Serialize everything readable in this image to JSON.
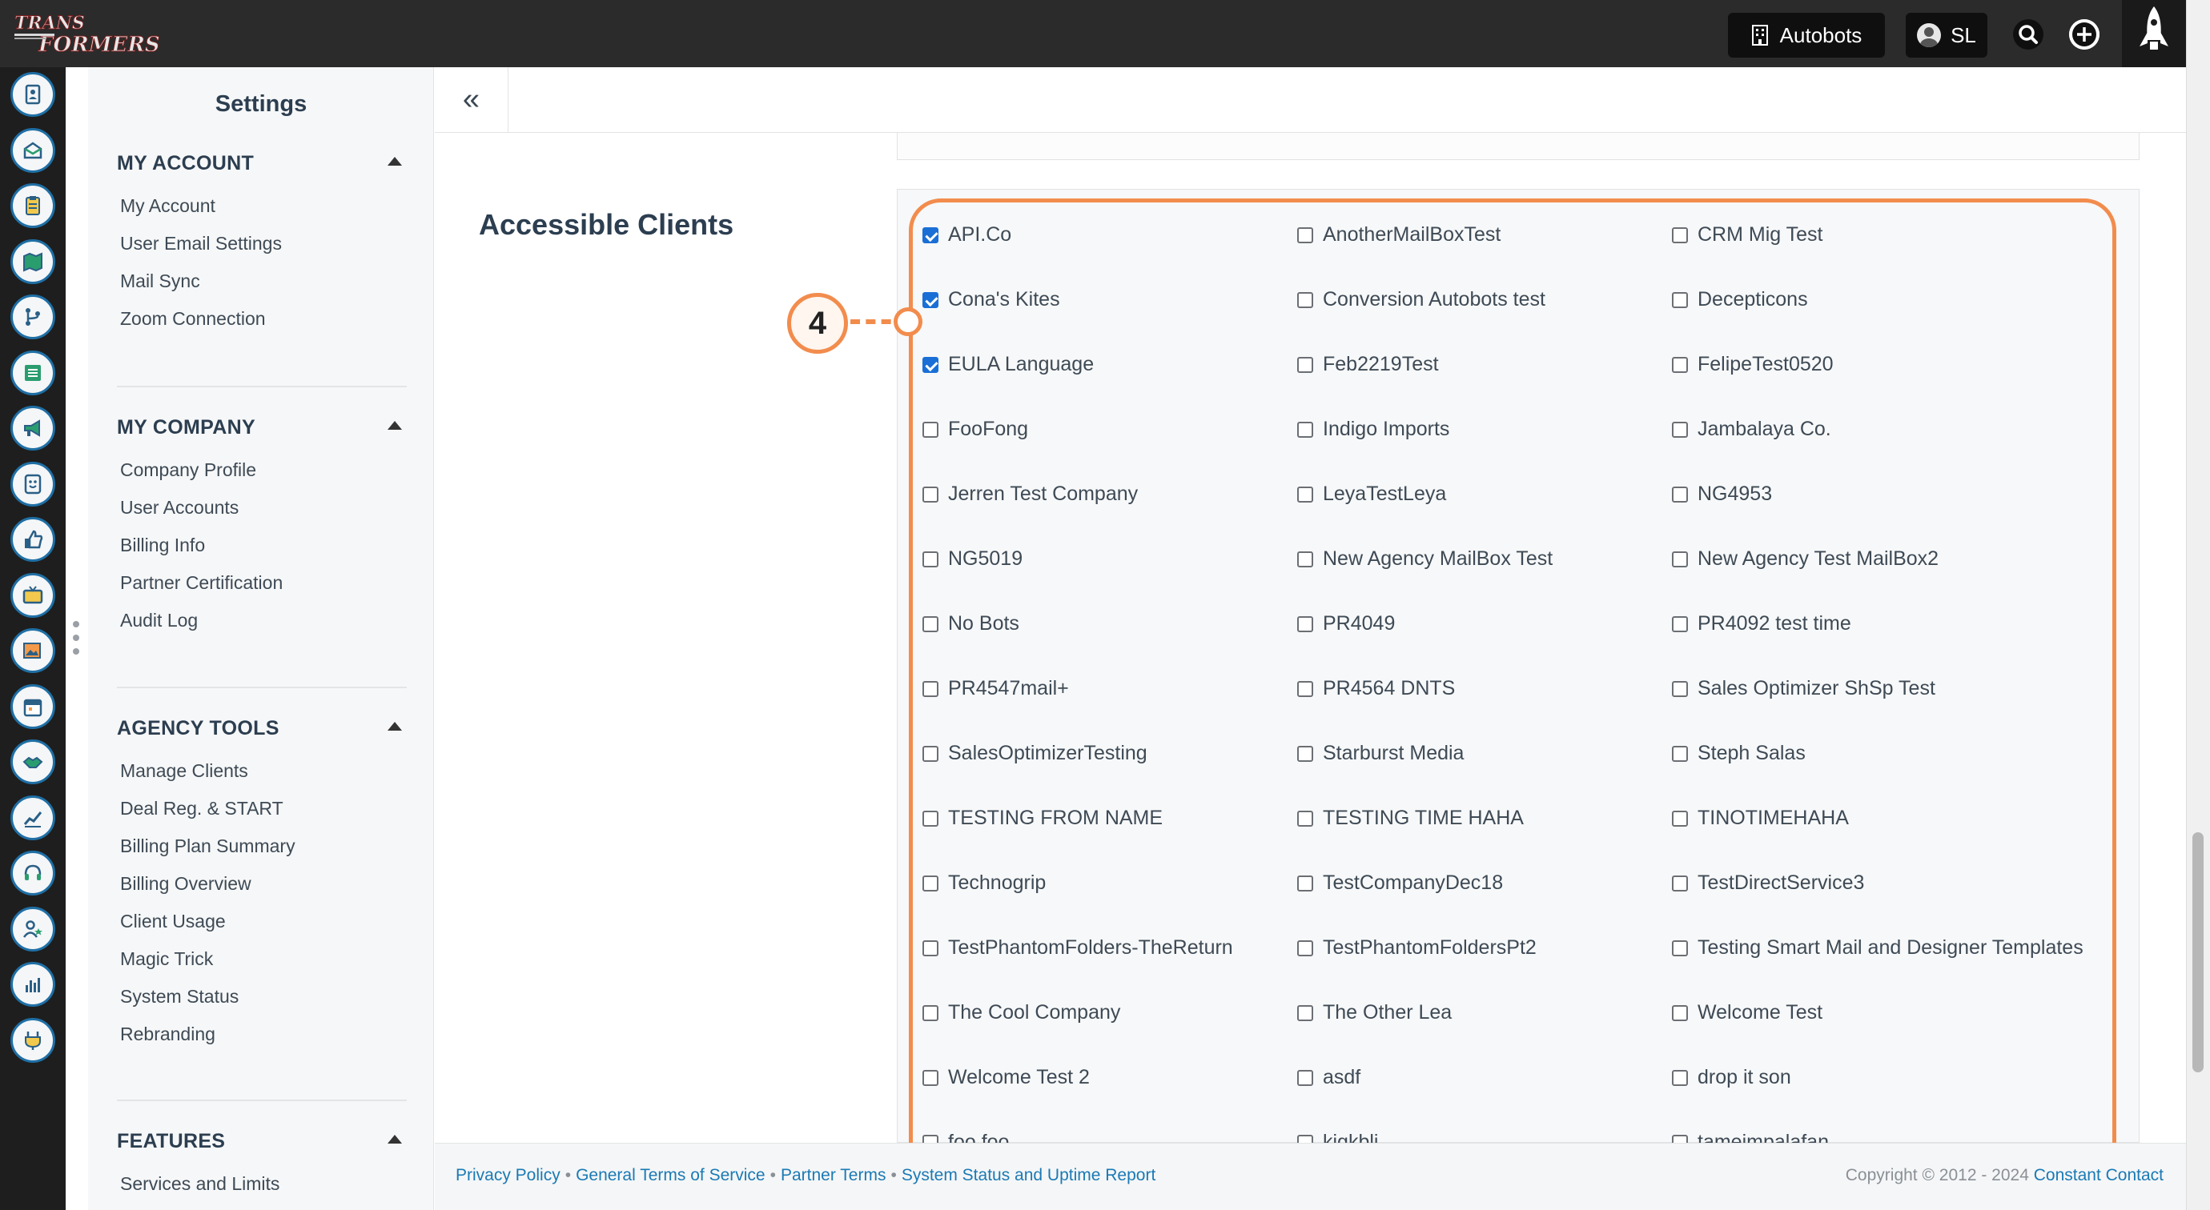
{
  "topbar": {
    "logo_text": "TRANSFORMERS",
    "org_label": "Autobots",
    "user_initials": "SL"
  },
  "rail": {
    "icons": [
      "contacts-icon",
      "email-icon",
      "clipboard-icon",
      "map-icon",
      "branch-icon",
      "list-icon",
      "megaphone-icon",
      "survey-icon",
      "thumbs-up-icon",
      "tv-icon",
      "image-icon",
      "calendar-icon",
      "handshake-icon",
      "analytics-icon",
      "headset-icon",
      "user-star-icon",
      "bar-chart-icon",
      "plug-icon"
    ]
  },
  "settings": {
    "title": "Settings",
    "sections": [
      {
        "head": "MY ACCOUNT",
        "links": [
          "My Account",
          "User Email Settings",
          "Mail Sync",
          "Zoom Connection"
        ]
      },
      {
        "head": "MY COMPANY",
        "links": [
          "Company Profile",
          "User Accounts",
          "Billing Info",
          "Partner Certification",
          "Audit Log"
        ]
      },
      {
        "head": "AGENCY TOOLS",
        "links": [
          "Manage Clients",
          "Deal Reg. & START",
          "Billing Plan Summary",
          "Billing Overview",
          "Client Usage",
          "Magic Trick",
          "System Status",
          "Rebranding"
        ]
      },
      {
        "head": "FEATURES",
        "links": [
          "Services and Limits"
        ]
      }
    ]
  },
  "main": {
    "collapse_label": "«",
    "section_label": "Accessible Clients",
    "callout_number": "4",
    "clients": [
      {
        "name": "API.Co",
        "checked": true
      },
      {
        "name": "AnotherMailBoxTest",
        "checked": false
      },
      {
        "name": "CRM Mig Test",
        "checked": false
      },
      {
        "name": "Cona's Kites",
        "checked": true
      },
      {
        "name": "Conversion Autobots test",
        "checked": false
      },
      {
        "name": "Decepticons",
        "checked": false
      },
      {
        "name": "EULA Language",
        "checked": true
      },
      {
        "name": "Feb2219Test",
        "checked": false
      },
      {
        "name": "FelipeTest0520",
        "checked": false
      },
      {
        "name": "FooFong",
        "checked": false
      },
      {
        "name": "Indigo Imports",
        "checked": false
      },
      {
        "name": "Jambalaya Co.",
        "checked": false
      },
      {
        "name": "Jerren Test Company",
        "checked": false
      },
      {
        "name": "LeyaTestLeya",
        "checked": false
      },
      {
        "name": "NG4953",
        "checked": false
      },
      {
        "name": "NG5019",
        "checked": false
      },
      {
        "name": "New Agency MailBox Test",
        "checked": false
      },
      {
        "name": "New Agency Test MailBox2",
        "checked": false
      },
      {
        "name": "No Bots",
        "checked": false
      },
      {
        "name": "PR4049",
        "checked": false
      },
      {
        "name": "PR4092 test time",
        "checked": false
      },
      {
        "name": "PR4547mail+",
        "checked": false
      },
      {
        "name": "PR4564 DNTS",
        "checked": false
      },
      {
        "name": "Sales Optimizer ShSp Test",
        "checked": false
      },
      {
        "name": "SalesOptimizerTesting",
        "checked": false
      },
      {
        "name": "Starburst Media",
        "checked": false
      },
      {
        "name": "Steph Salas",
        "checked": false
      },
      {
        "name": "TESTING FROM NAME",
        "checked": false
      },
      {
        "name": "TESTING TIME HAHA",
        "checked": false
      },
      {
        "name": "TINOTIMEHAHA",
        "checked": false
      },
      {
        "name": "Technogrip",
        "checked": false
      },
      {
        "name": "TestCompanyDec18",
        "checked": false
      },
      {
        "name": "TestDirectService3",
        "checked": false
      },
      {
        "name": "TestPhantomFolders-TheReturn",
        "checked": false
      },
      {
        "name": "TestPhantomFoldersPt2",
        "checked": false
      },
      {
        "name": "Testing Smart Mail and Designer Templates",
        "checked": false
      },
      {
        "name": "The Cool Company",
        "checked": false
      },
      {
        "name": "The Other Lea",
        "checked": false
      },
      {
        "name": "Welcome Test",
        "checked": false
      },
      {
        "name": "Welcome Test 2",
        "checked": false
      },
      {
        "name": "asdf",
        "checked": false
      },
      {
        "name": "drop it son",
        "checked": false
      },
      {
        "name": "foo foo",
        "checked": false
      },
      {
        "name": "kjgkblj",
        "checked": false
      },
      {
        "name": "tameimpalafan",
        "checked": false
      }
    ]
  },
  "footer": {
    "links": [
      "Privacy Policy",
      "General Terms of Service",
      "Partner Terms",
      "System Status and Uptime Report"
    ],
    "separator": "•",
    "copyright": "Copyright © 2012 - 2024",
    "brand": "Constant Contact"
  },
  "colors": {
    "accent_orange": "#f28c4d",
    "link_blue": "#1a7ab5",
    "checkbox_blue": "#1a6fd6",
    "rail_ring": "#1f6fa5"
  }
}
